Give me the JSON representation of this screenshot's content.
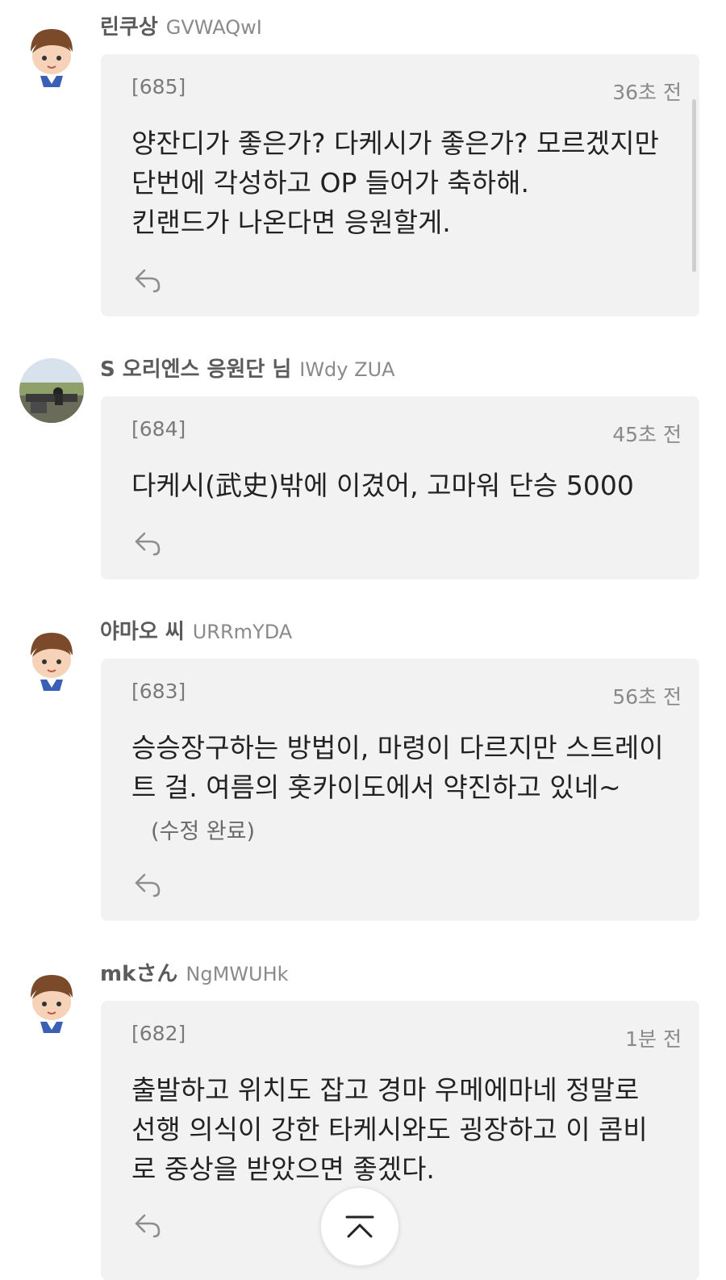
{
  "comments": [
    {
      "name": "린쿠상",
      "uid": "GVWAQwI",
      "num": "[685]",
      "time": "36초 전",
      "body": "양잔디가 좋은가? 다케시가 좋은가? 모르겠지만\n단번에 각성하고 OP 들어가 축하해.\n킨랜드가 나온다면 응원할게.",
      "avatar_icon": "boy-avatar-icon"
    },
    {
      "name": "S 오리엔스 응원단 님",
      "uid": "IWdy ZUA",
      "num": "[684]",
      "time": "45초 전",
      "body": "다케시(武史)밖에 이겼어, 고마워 단승 5000",
      "avatar_icon": "photo-avatar-icon"
    },
    {
      "name": "야마오 씨",
      "uid": "URRmYDA",
      "num": "[683]",
      "time": "56초 전",
      "body": "승승장구하는 방법이, 마령이 다르지만 스트레이\n트 걸. 여름의 홋카이도에서 약진하고 있네~",
      "edited": "(수정 완료)",
      "avatar_icon": "boy-avatar-icon"
    },
    {
      "name": "mkさん",
      "uid": "NgMWUHk",
      "num": "[682]",
      "time": "1분 전",
      "body": "출발하고 위치도 잡고 경마 우메에마네 정말로\n선행 의식이 강한 타케시와도 굉장하고 이 콤비\n로 중상을 받았으면 좋겠다.",
      "avatar_icon": "boy-avatar-icon"
    }
  ],
  "icons": {
    "reply": "reply-arrow-icon",
    "scroll_top": "chevron-up-icon"
  },
  "colors": {
    "card_bg": "#f2f2f2",
    "name": "#5b5b5b",
    "meta": "#8a8a8a"
  }
}
